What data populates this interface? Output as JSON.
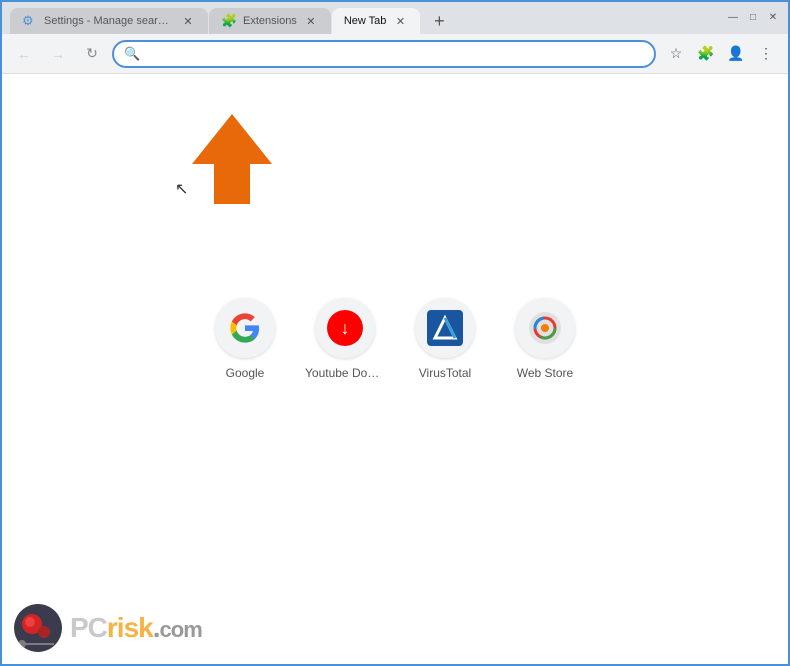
{
  "browser": {
    "tabs": [
      {
        "id": "tab-settings",
        "label": "Settings - Manage search engi...",
        "favicon": "⚙",
        "favicon_color": "#4a90d9",
        "active": false,
        "closable": true
      },
      {
        "id": "tab-extensions",
        "label": "Extensions",
        "favicon": "🧩",
        "favicon_color": "#4a90d9",
        "active": false,
        "closable": true
      },
      {
        "id": "tab-newtab",
        "label": "New Tab",
        "favicon": "",
        "active": true,
        "closable": true
      }
    ],
    "new_tab_button": "+",
    "address_bar": {
      "value": "",
      "placeholder": ""
    },
    "nav": {
      "back": "←",
      "forward": "→",
      "reload": "↻"
    },
    "window_controls": {
      "minimize": "—",
      "maximize": "□",
      "close": "✕"
    }
  },
  "shortcuts": [
    {
      "id": "google",
      "label": "Google",
      "icon_type": "google"
    },
    {
      "id": "youtube-downloader",
      "label": "Youtube Dow...",
      "icon_type": "youtube-dl"
    },
    {
      "id": "virustotal",
      "label": "VirusTotal",
      "icon_type": "virustotal"
    },
    {
      "id": "web-store",
      "label": "Web Store",
      "icon_type": "webstore"
    }
  ],
  "watermark": {
    "site": "PCrisk.com"
  }
}
